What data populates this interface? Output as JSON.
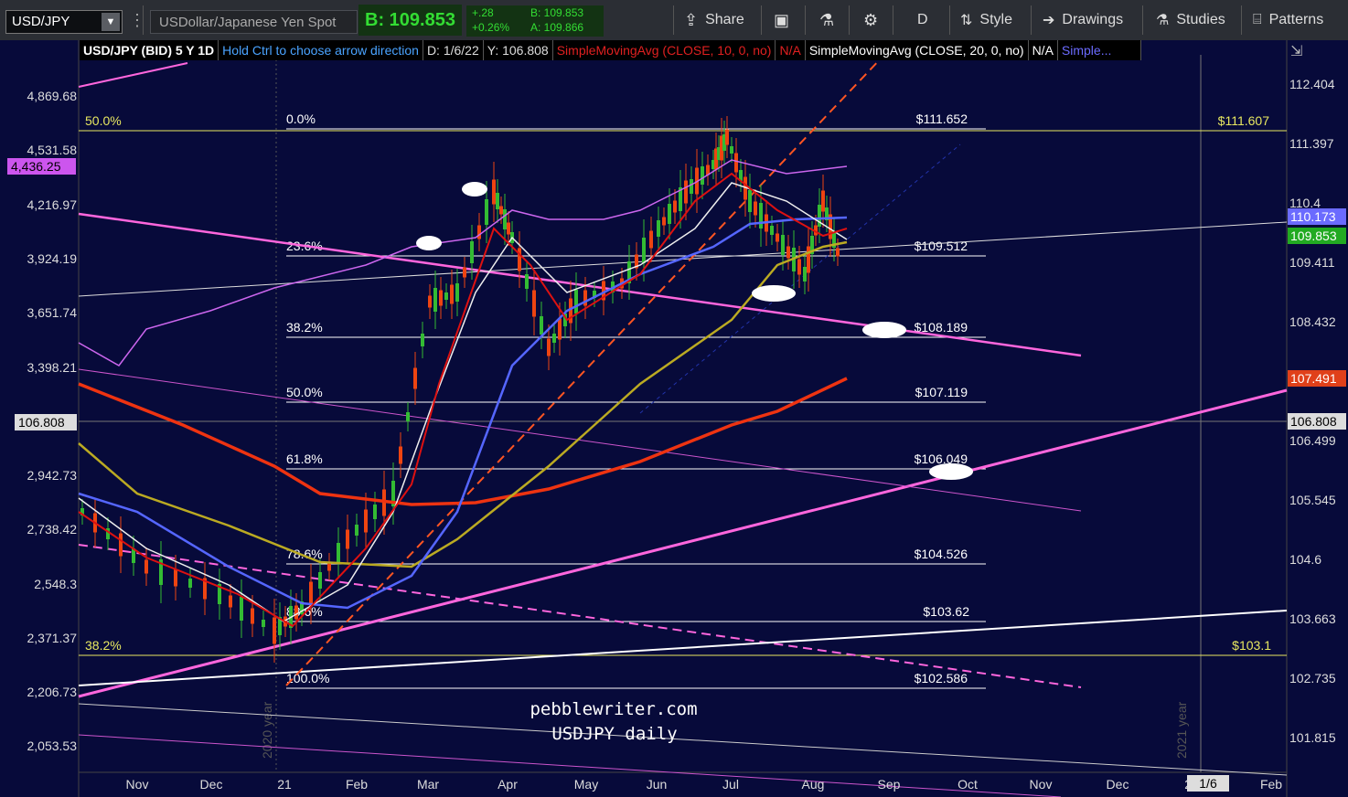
{
  "toolbar": {
    "symbol": "USD/JPY",
    "description": "USDollar/Japanese Yen Spot",
    "bid": "B: 109.853",
    "change": "+.28",
    "change_pct": "+0.26%",
    "bid_small": "B: 109.853",
    "ask_small": "A: 109.866",
    "share": "Share",
    "period": "D",
    "style": "Style",
    "drawings": "Drawings",
    "studies": "Studies",
    "patterns": "Patterns"
  },
  "infobar": {
    "title": "USD/JPY (BID) 5 Y 1D",
    "hint": "Hold Ctrl to choose arrow direction",
    "date": "D: 1/6/22",
    "yval": "Y: 106.808",
    "sma1": "SimpleMovingAvg (CLOSE, 10, 0, no)",
    "na1": "N/A",
    "sma2": "SimpleMovingAvg (CLOSE, 20, 0, no)",
    "na2": "N/A",
    "more": "Simple..."
  },
  "chart_data": {
    "type": "candlestick",
    "right_axis_ticks": [
      "112.404",
      "111.397",
      "110.4",
      "109.411",
      "108.432",
      "107.49",
      "106.499",
      "105.545",
      "104.6",
      "103.663",
      "102.735",
      "101.815"
    ],
    "left_axis_ticks": [
      "4,869.68",
      "4,531.58",
      "4,216.97",
      "3,924.19",
      "3,651.74",
      "3,398.21",
      "2,942.73",
      "2,738.42",
      "2,548.3",
      "2,371.37",
      "2,206.73",
      "2,053.53"
    ],
    "months": [
      "Nov",
      "Dec",
      "21",
      "Feb",
      "Mar",
      "Apr",
      "May",
      "Jun",
      "Jul",
      "Aug",
      "Sep",
      "Oct",
      "Nov",
      "Dec",
      "22",
      "Feb"
    ],
    "year_labels": [
      "2020 year",
      "2021 year"
    ],
    "price_tags": [
      {
        "label": "110.173",
        "color": "#6b6bff"
      },
      {
        "label": "109.853",
        "color": "#22aa22"
      },
      {
        "label": "107.491",
        "color": "#e0401a"
      },
      {
        "label": "106.808",
        "color": "#dddddd"
      }
    ],
    "left_tag": "4,436.25",
    "left_crosshair": "106.808",
    "x_cursor": "1/6",
    "fibonacci": [
      {
        "pct": "0.0%",
        "price": "$111.652"
      },
      {
        "pct": "23.6%",
        "price": "$109.512"
      },
      {
        "pct": "38.2%",
        "price": "$108.189"
      },
      {
        "pct": "50.0%",
        "price": "$107.119"
      },
      {
        "pct": "61.8%",
        "price": "$106.049"
      },
      {
        "pct": "78.6%",
        "price": "$104.526"
      },
      {
        "pct": "88.6%",
        "price": "$103.62"
      },
      {
        "pct": "100.0%",
        "price": "$102.586"
      }
    ],
    "fib_outer": [
      {
        "pct": "50.0%",
        "price": "$111.607"
      },
      {
        "pct": "38.2%",
        "price": "$103.1"
      }
    ],
    "watermark": [
      "pebblewriter.com",
      "USDJPY daily"
    ],
    "colors": {
      "background": "#070a3a",
      "up": "#33bb33",
      "down": "#ee4411",
      "ma10": "#dd1111",
      "ma20": "#eeeeee",
      "ma50": "#5566ff",
      "ma100": "#bbaa22",
      "ma200": "#ee3311",
      "spx": "#cc66ee",
      "trend": "#ff66dd"
    }
  }
}
